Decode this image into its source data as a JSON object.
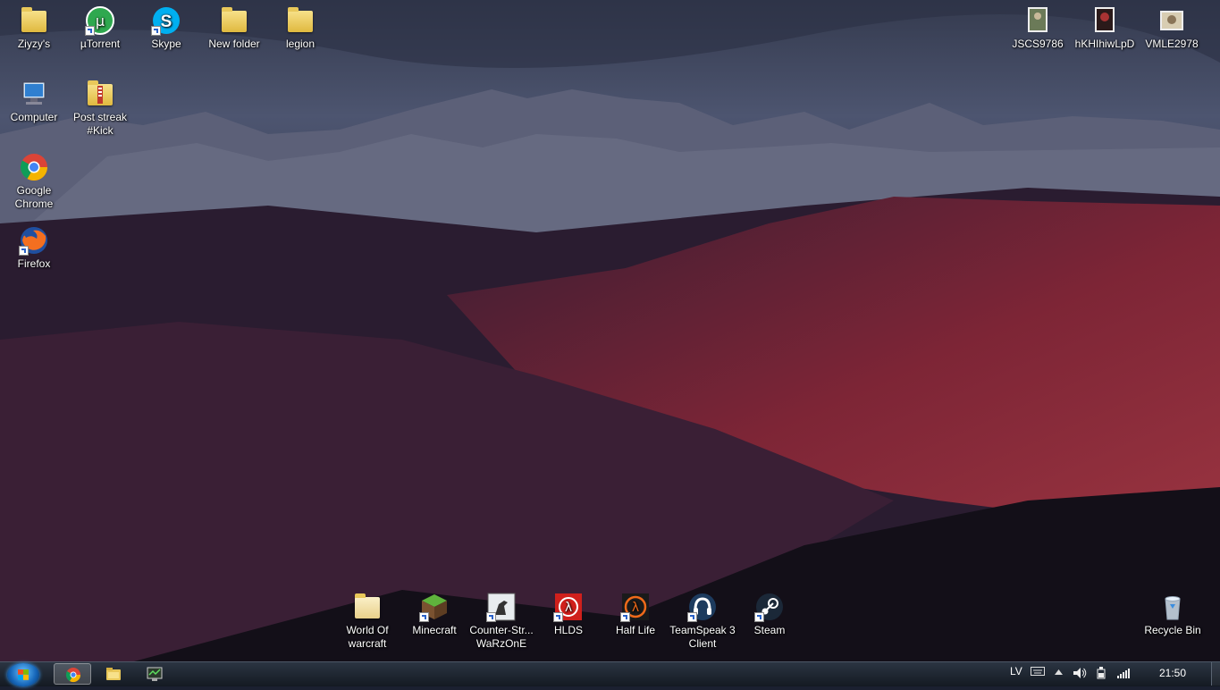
{
  "desktop": {
    "icons_top": [
      {
        "label": "Ziyzy's",
        "icon": "user-folder-icon"
      },
      {
        "label": "µTorrent",
        "icon": "utorrent-icon"
      },
      {
        "label": "Skype",
        "icon": "skype-icon"
      },
      {
        "label": "New folder",
        "icon": "folder-icon"
      },
      {
        "label": "legion",
        "icon": "folder-icon"
      }
    ],
    "icons_left": [
      {
        "label": "Computer",
        "icon": "computer-icon"
      },
      {
        "label": "Post streak #Kick",
        "icon": "zip-folder-icon"
      },
      {
        "label": "Google Chrome",
        "icon": "chrome-icon"
      },
      {
        "label": "Firefox",
        "icon": "firefox-icon"
      }
    ],
    "icons_top_right": [
      {
        "label": "JSCS9786",
        "icon": "image-file-icon"
      },
      {
        "label": "hKHIhiwLpD",
        "icon": "image-file-icon"
      },
      {
        "label": "VMLE2978",
        "icon": "image-file-icon"
      }
    ],
    "icons_bottom": [
      {
        "label": "World Of warcraft",
        "icon": "folder-icon"
      },
      {
        "label": "Minecraft",
        "icon": "minecraft-icon"
      },
      {
        "label": "Counter-Str... WaRzOnE",
        "icon": "counter-strike-icon"
      },
      {
        "label": "HLDS",
        "icon": "hlds-icon"
      },
      {
        "label": "Half Life",
        "icon": "half-life-icon"
      },
      {
        "label": "TeamSpeak 3 Client",
        "icon": "teamspeak-icon"
      },
      {
        "label": "Steam",
        "icon": "steam-icon"
      }
    ],
    "recycle_bin": {
      "label": "Recycle Bin",
      "icon": "recycle-bin-icon"
    }
  },
  "taskbar": {
    "pinned": [
      "chrome-icon",
      "explorer-icon",
      "monitor-app-icon"
    ],
    "language": "LV",
    "clock": "21:50"
  },
  "colors": {
    "taskbar": "#1a212b",
    "sky": "#4a5068",
    "mountain_red": "#8a2a3a"
  }
}
